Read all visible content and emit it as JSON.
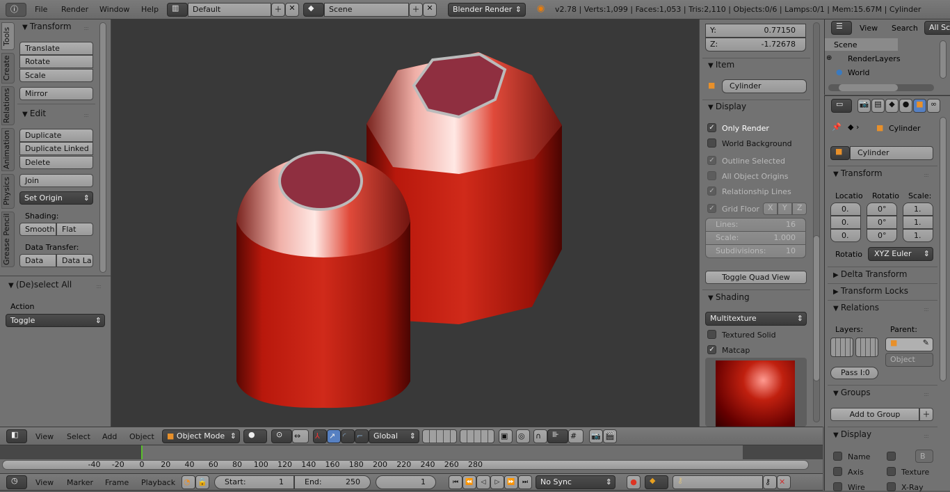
{
  "topbar": {
    "menus": [
      "File",
      "Render",
      "Window",
      "Help"
    ],
    "layout": "Default",
    "scene": "Scene",
    "engine": "Blender Render",
    "stats": "v2.78 | Verts:1,099 | Faces:1,053 | Tris:2,110 | Objects:0/6 | Lamps:0/1 | Mem:15.67M | Cylinder"
  },
  "toolshelf": {
    "tabs": [
      "Tools",
      "Create",
      "Relations",
      "Animation",
      "Physics",
      "Grease Pencil"
    ],
    "transform": {
      "title": "Transform",
      "buttons": [
        "Translate",
        "Rotate",
        "Scale"
      ],
      "mirror": "Mirror"
    },
    "edit": {
      "title": "Edit",
      "buttons": [
        "Duplicate",
        "Duplicate Linked",
        "Delete"
      ],
      "join": "Join",
      "set_origin": "Set Origin",
      "shading_label": "Shading:",
      "smooth": "Smooth",
      "flat": "Flat",
      "data_transfer_label": "Data Transfer:",
      "data": "Data",
      "data_layers": "Data La"
    },
    "operator": {
      "title": "(De)select All",
      "action_label": "Action",
      "action_value": "Toggle"
    }
  },
  "npanel": {
    "y_label": "Y:",
    "y_value": "0.77150",
    "z_label": "Z:",
    "z_value": "-1.72678",
    "item": {
      "title": "Item",
      "name": "Cylinder"
    },
    "display": {
      "title": "Display",
      "only_render": "Only Render",
      "world_background": "World Background",
      "outline_selected": "Outline Selected",
      "all_object_origins": "All Object Origins",
      "relationship_lines": "Relationship Lines",
      "grid_floor": "Grid Floor",
      "axes": [
        "X",
        "Y",
        "Z"
      ],
      "lines_label": "Lines:",
      "lines": "16",
      "scale_label": "Scale:",
      "scale": "1.000",
      "subdiv_label": "Subdivisions:",
      "subdiv": "10",
      "toggle_quad": "Toggle Quad View"
    },
    "shading": {
      "title": "Shading",
      "mode": "Multitexture",
      "textured_solid": "Textured Solid",
      "matcap": "Matcap"
    }
  },
  "outliner": {
    "view": "View",
    "search": "Search",
    "filter": "All Sc",
    "items": [
      "Scene",
      "RenderLayers",
      "World"
    ]
  },
  "properties": {
    "object_name": "Cylinder",
    "name_field": "Cylinder",
    "transform": {
      "title": "Transform",
      "location": "Locatio",
      "rotation": "Rotatio",
      "scale": "Scale:",
      "loc_vals": [
        "0.",
        "0.",
        "0."
      ],
      "rot_vals": [
        "0°",
        "0°",
        "0°"
      ],
      "scale_vals": [
        "1.",
        "1.",
        "1."
      ],
      "rot_mode_label": "Rotatio",
      "rot_mode": "XYZ Euler"
    },
    "delta": "Delta Transform",
    "locks": "Transform Locks",
    "relations": {
      "title": "Relations",
      "layers": "Layers:",
      "parent": "Parent:",
      "parent_type": "Object",
      "pass": "Pass I:0"
    },
    "groups": {
      "title": "Groups",
      "add": "Add to Group"
    },
    "display": {
      "title": "Display",
      "name": "Name",
      "axis": "Axis",
      "wire": "Wire",
      "texture": "Texture",
      "xray": "X-Ray",
      "bounds": "B"
    }
  },
  "view3d_header": {
    "menus": [
      "View",
      "Select",
      "Add",
      "Object"
    ],
    "mode": "Object Mode",
    "orientation": "Global"
  },
  "timeline": {
    "ticks": [
      "-40",
      "-20",
      "0",
      "20",
      "40",
      "60",
      "80",
      "100",
      "120",
      "140",
      "160",
      "180",
      "200",
      "220",
      "240",
      "260",
      "280"
    ],
    "current_frame": 0,
    "menus": [
      "View",
      "Marker",
      "Frame",
      "Playback"
    ],
    "start_label": "Start:",
    "start": "1",
    "end_label": "End:",
    "end": "250",
    "frame": "1",
    "sync": "No Sync"
  },
  "colors": {
    "viewport": "#393939",
    "object": "#b3140a",
    "accent": "#5680c2",
    "frame_marker": "#5ac02c"
  }
}
